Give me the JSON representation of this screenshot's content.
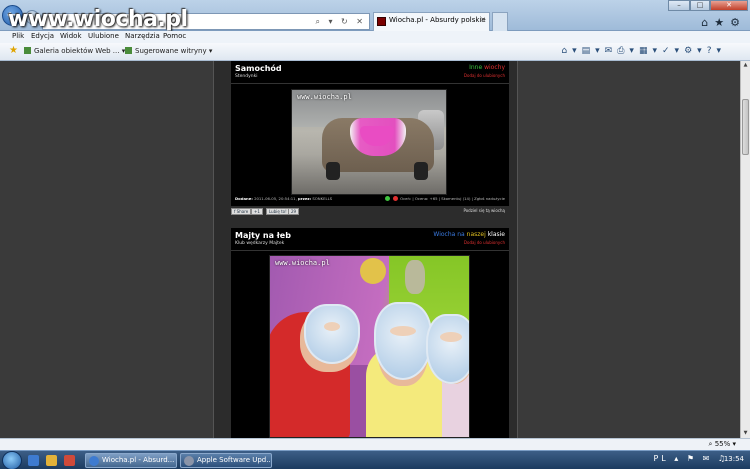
{
  "browser": {
    "logo_text": "www.wiocha.pl",
    "tab_title": "Wiocha.pl - Absurdy polskie",
    "address_icons": "⌕ ▾ ↻ ✕",
    "menu": [
      "Plik",
      "Edycja",
      "Widok",
      "Ulubione",
      "Narzędzia",
      "Pomoc"
    ],
    "favorites": [
      {
        "label": "Galeria obiektów Web ..."
      },
      {
        "label": "Sugerowane witryny"
      }
    ],
    "zoom": "55%"
  },
  "posts": [
    {
      "title": "Samochód",
      "author": "Stendynki",
      "right_label_a": "Inne",
      "right_label_b": "wiochy",
      "right_sub": "Dodaj do ulubionych",
      "watermark": "www.wiocha.pl",
      "footer_left_label": "Dodane:",
      "footer_left_value": "2011-06-05, 20:54:11,",
      "footer_mid_label": "przez:",
      "footer_mid_value": "SONKELLS",
      "footer_right": "Oceń:  | Ocena: +65 | Skomentuj (14) | Zgłoś nadużycie",
      "share_btn": "f Share",
      "plus_btn": "+1",
      "like_btn": "Lubię to!",
      "like_count": "29",
      "podziel": "Podziel się tą wiochą"
    },
    {
      "title": "Majty na łeb",
      "author": "Klub wędkarzy Majtek",
      "right_label_a": "Wiocha",
      "right_label_b": "na",
      "right_label_c": "naszej",
      "right_label_d": "klasie",
      "right_sub": "Dodaj do ulubionych",
      "watermark": "www.wiocha.pl"
    }
  ],
  "taskbar": {
    "tasks": [
      {
        "label": "Wiocha.pl - Absurd..."
      },
      {
        "label": "Apple Software Upd..."
      }
    ],
    "tray": "PL ▴ ⚑ ✉ ♫",
    "clock": "13:54"
  }
}
